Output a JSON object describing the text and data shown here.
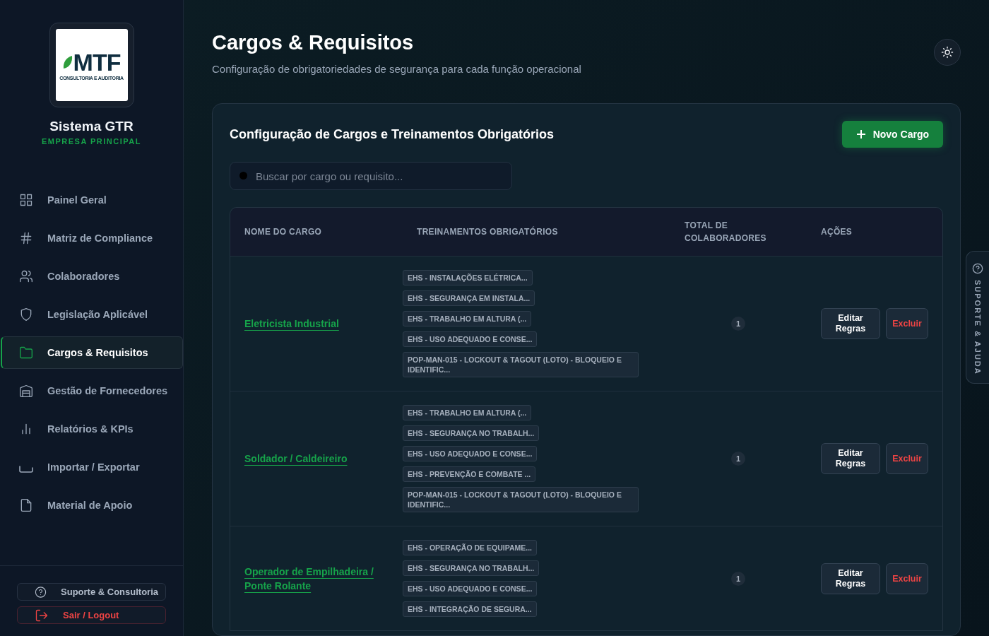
{
  "sidebar": {
    "logo": {
      "mark": "MTF",
      "tagline": "CONSULTORIA E AUDITORIA"
    },
    "title": "Sistema GTR",
    "subtitle": "EMPRESA PRINCIPAL",
    "items": [
      {
        "label": "Painel Geral",
        "selected": false
      },
      {
        "label": "Matriz de Compliance",
        "selected": false
      },
      {
        "label": "Colaboradores",
        "selected": false
      },
      {
        "label": "Legislação Aplicável",
        "selected": false
      },
      {
        "label": "Cargos & Requisitos",
        "selected": true
      },
      {
        "label": "Gestão de Fornecedores",
        "selected": false
      },
      {
        "label": "Relatórios & KPIs",
        "selected": false
      },
      {
        "label": "Importar / Exportar",
        "selected": false
      },
      {
        "label": "Material de Apoio",
        "selected": false
      }
    ],
    "footer": [
      {
        "label": "Suporte & Consultoria",
        "kind": "support"
      },
      {
        "label": "Sair / Logout",
        "kind": "logout"
      }
    ]
  },
  "header": {
    "title": "Cargos & Requisitos",
    "subtitle": "Configuração de obrigatoriedades de segurança para cada função operacional"
  },
  "card": {
    "title": "Configuração de Cargos e Treinamentos Obrigatórios",
    "new_button": "Novo Cargo",
    "search": {
      "placeholder": "Buscar por cargo ou requisito..."
    },
    "table": {
      "columns": [
        "NOME DO CARGO",
        "TREINAMENTOS OBRIGATÓRIOS",
        "TOTAL DE COLABORADORES",
        "AÇÕES"
      ],
      "rows": [
        {
          "name": "Eletricista Industrial",
          "trainings": [
            "EHS - INSTALAÇÕES ELÉTRICA...",
            "EHS - SEGURANÇA EM INSTALA...",
            "EHS - TRABALHO EM ALTURA (...",
            "EHS - USO ADEQUADO E CONSE...",
            "POP-MAN-015 - LOCKOUT & TAGOUT (LOTO) - BLOQUEIO E IDENTIFIC..."
          ],
          "total": "1",
          "edit": "Editar Regras",
          "delete": "Excluir"
        },
        {
          "name": "Soldador / Caldeireiro",
          "trainings": [
            "EHS - TRABALHO EM ALTURA (...",
            "EHS - SEGURANÇA NO TRABALH...",
            "EHS - USO ADEQUADO E CONSE...",
            "EHS - PREVENÇÃO E COMBATE ...",
            "POP-MAN-015 - LOCKOUT & TAGOUT (LOTO) - BLOQUEIO E IDENTIFIC..."
          ],
          "total": "1",
          "edit": "Editar Regras",
          "delete": "Excluir"
        },
        {
          "name": "Operador de Empilhadeira / Ponte Rolante",
          "trainings": [
            "EHS - OPERAÇÃO DE EQUIPAME...",
            "EHS - SEGURANÇA NO TRABALH...",
            "EHS - USO ADEQUADO E CONSE...",
            "EHS - INTEGRAÇÃO DE SEGURA..."
          ],
          "total": "1",
          "edit": "Editar Regras",
          "delete": "Excluir"
        }
      ]
    }
  },
  "help_tab": {
    "label": "SUPORTE & AJUDA"
  }
}
